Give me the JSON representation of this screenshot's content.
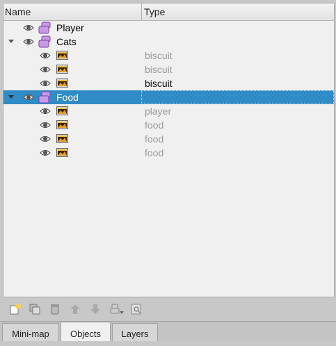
{
  "header": {
    "name_col": "Name",
    "type_col": "Type"
  },
  "rows": [
    {
      "name": "Player",
      "type": "",
      "kind": "group",
      "level": 0,
      "expanded": false,
      "selected": false,
      "type_dark": false
    },
    {
      "name": "Cats",
      "type": "",
      "kind": "group",
      "level": 0,
      "expanded": true,
      "selected": false,
      "type_dark": false
    },
    {
      "name": "",
      "type": "biscuit",
      "kind": "image",
      "level": 1,
      "selected": false,
      "type_dark": false
    },
    {
      "name": "",
      "type": "biscuit",
      "kind": "image",
      "level": 1,
      "selected": false,
      "type_dark": false
    },
    {
      "name": "",
      "type": "biscuit",
      "kind": "image",
      "level": 1,
      "selected": false,
      "type_dark": true
    },
    {
      "name": "Food",
      "type": "",
      "kind": "group",
      "level": 0,
      "expanded": true,
      "selected": true,
      "type_dark": false
    },
    {
      "name": "",
      "type": "player",
      "kind": "image",
      "level": 1,
      "selected": false,
      "type_dark": false
    },
    {
      "name": "",
      "type": "food",
      "kind": "image",
      "level": 1,
      "selected": false,
      "type_dark": false
    },
    {
      "name": "",
      "type": "food",
      "kind": "image",
      "level": 1,
      "selected": false,
      "type_dark": false
    },
    {
      "name": "",
      "type": "food",
      "kind": "image",
      "level": 1,
      "selected": false,
      "type_dark": false
    }
  ],
  "toolbar": [
    "new-object-icon",
    "duplicate-icon",
    "delete-icon",
    "move-up-icon",
    "move-down-icon",
    "group-icon",
    "find-icon"
  ],
  "tabs": [
    {
      "label": "Mini-map",
      "active": false
    },
    {
      "label": "Objects",
      "active": true
    },
    {
      "label": "Layers",
      "active": false
    }
  ]
}
